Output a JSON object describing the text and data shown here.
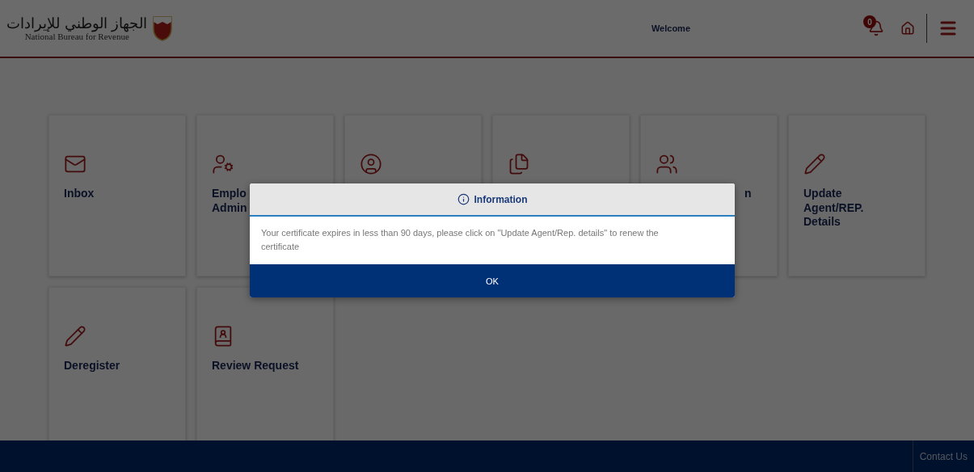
{
  "header": {
    "logo_arabic": "الجهاز الوطني للإيرادات",
    "logo_english": "National Bureau for Revenue",
    "welcome": "Welcome",
    "notification_count": "0"
  },
  "tiles": [
    {
      "kind": "plain",
      "label": [
        "Inbox"
      ]
    },
    {
      "kind": "plain",
      "label": [
        "Emplo",
        "Admin"
      ]
    },
    {
      "kind": "icon"
    },
    {
      "kind": "icon"
    },
    {
      "kind": "covered",
      "label": [
        "n"
      ]
    },
    {
      "kind": "plain",
      "label": [
        "Update",
        "Agent/REP.",
        "Details"
      ]
    },
    {
      "kind": "plain",
      "label": [
        "Deregister"
      ]
    },
    {
      "kind": "plain",
      "label": [
        "Review Request"
      ]
    }
  ],
  "footer": {
    "link": "Contact Us"
  },
  "dialog": {
    "title": "Information",
    "message": "Your certificate expires in less than 90 days, please click on \"Update Agent/Rep. details\" to renew the certificate",
    "button": "OK"
  }
}
